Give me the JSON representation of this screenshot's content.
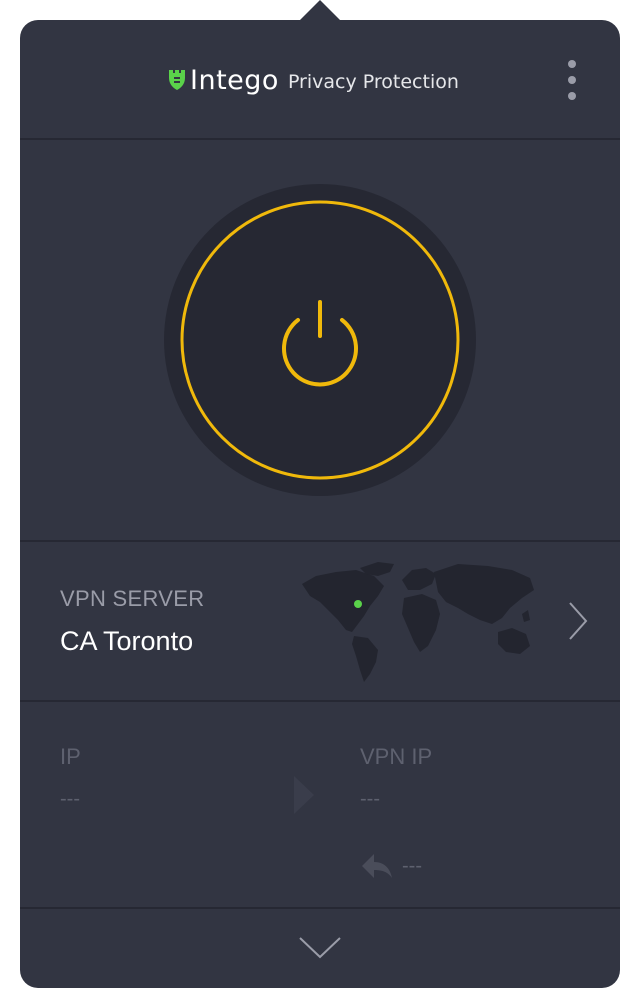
{
  "header": {
    "brand_name": "Intego",
    "product_name": "Privacy Protection"
  },
  "vpn_server": {
    "label": "VPN SERVER",
    "name": "CA Toronto"
  },
  "ip_info": {
    "ip_label": "IP",
    "ip_value": "---",
    "vpn_ip_label": "VPN IP",
    "vpn_ip_value": "---",
    "return_value": "---"
  },
  "colors": {
    "panel_bg": "#323542",
    "power_accent": "#f0b90b",
    "brand_green": "#5ad24a",
    "location_dot": "#5ad24a"
  },
  "icons": {
    "brand": "intego-castle-icon",
    "menu": "kebab-menu-icon",
    "power": "power-icon",
    "server_select": "chevron-right-icon",
    "ip_arrow": "arrow-right-icon",
    "return": "reply-arrow-icon",
    "expand": "chevron-down-icon"
  }
}
